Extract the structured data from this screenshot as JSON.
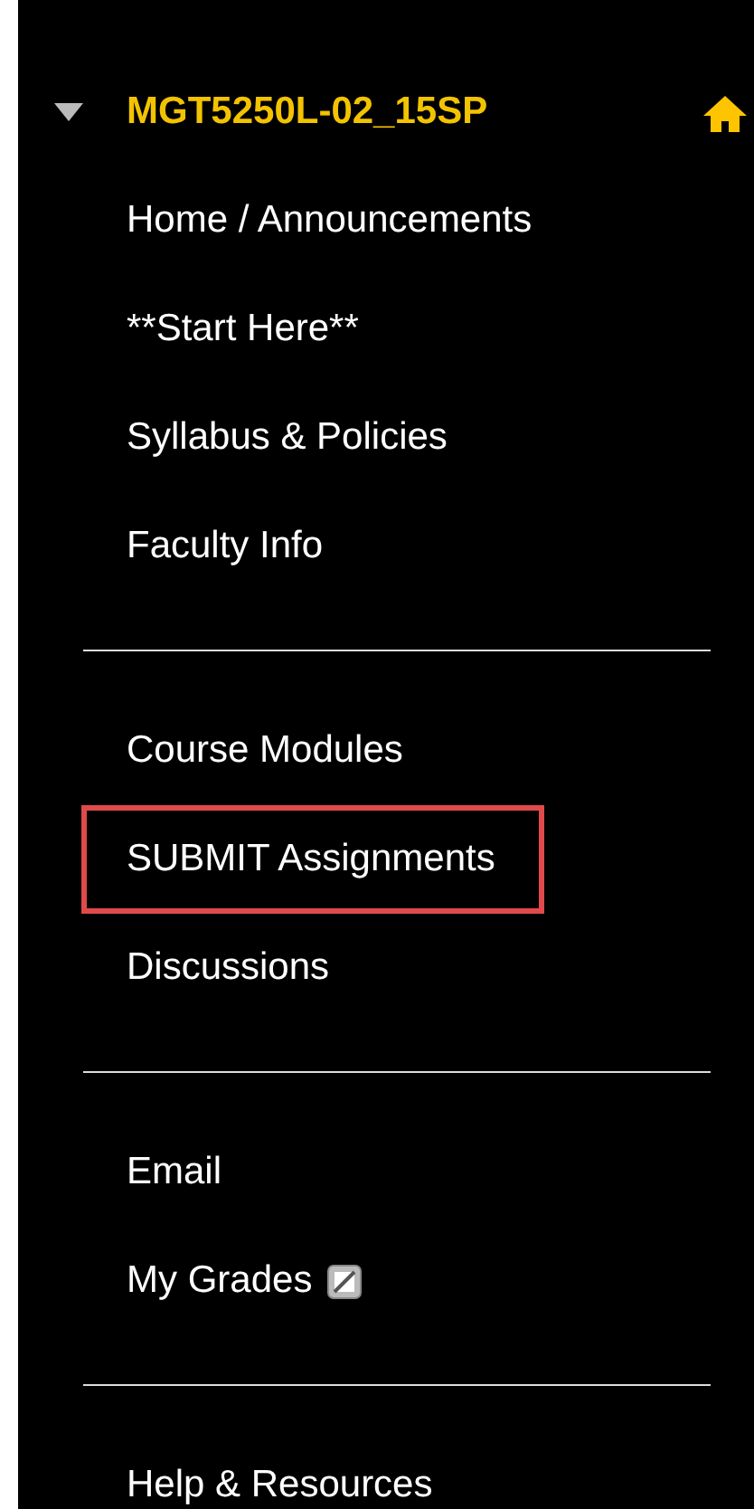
{
  "course": {
    "title": "MGT5250L-02_15SP",
    "expanded": true
  },
  "sections": [
    {
      "items": [
        {
          "label": "Home / Announcements",
          "kind": "link",
          "highlighted": false
        },
        {
          "label": "**Start Here**",
          "kind": "link",
          "highlighted": false
        },
        {
          "label": "Syllabus & Policies",
          "kind": "link",
          "highlighted": false
        },
        {
          "label": "Faculty Info",
          "kind": "link",
          "highlighted": false
        }
      ]
    },
    {
      "items": [
        {
          "label": "Course Modules",
          "kind": "link",
          "highlighted": false
        },
        {
          "label": "SUBMIT Assignments",
          "kind": "link",
          "highlighted": true
        },
        {
          "label": "Discussions",
          "kind": "link",
          "highlighted": false
        }
      ]
    },
    {
      "items": [
        {
          "label": "Email",
          "kind": "link",
          "highlighted": false
        },
        {
          "label": "My Grades",
          "kind": "tool",
          "highlighted": false
        }
      ]
    },
    {
      "items": [
        {
          "label": "Help & Resources",
          "kind": "link",
          "highlighted": false
        }
      ]
    }
  ]
}
